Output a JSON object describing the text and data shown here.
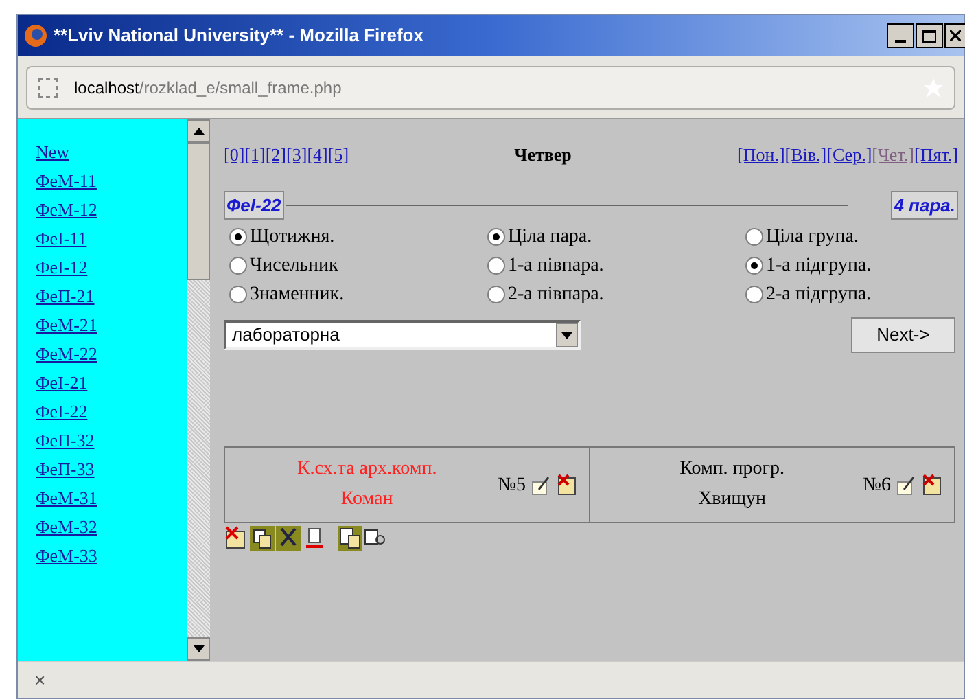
{
  "window": {
    "title": "**Lviv National University** - Mozilla Firefox"
  },
  "address_bar": {
    "host": "localhost",
    "path": "/rozklad_e/small_frame.php"
  },
  "sidebar": {
    "items": [
      "New",
      "ФеМ-11",
      "ФеМ-12",
      "ФеІ-11",
      "ФеІ-12",
      "ФеП-21",
      "ФеМ-21",
      "ФеМ-22",
      "ФеІ-21",
      "ФеІ-22",
      "ФеП-32",
      "ФеП-33",
      "ФеМ-31",
      "ФеМ-32",
      "ФеМ-33"
    ]
  },
  "pair_links": [
    "[0]",
    "[1]",
    "[2]",
    "[3]",
    "[4]",
    "[5]"
  ],
  "day_title": "Четвер",
  "day_links": [
    {
      "label": "[Пон.]",
      "selected": false
    },
    {
      "label": "[Вів.]",
      "selected": false
    },
    {
      "label": "[Сер.]",
      "selected": false
    },
    {
      "label": "[Чет.]",
      "selected": true
    },
    {
      "label": "[Пят.]",
      "selected": false
    }
  ],
  "group": "ФеІ-22",
  "pair": "4 пара.",
  "radio_groups": [
    [
      {
        "label": "Щотижня.",
        "selected": true
      },
      {
        "label": "Чисельник",
        "selected": false
      },
      {
        "label": "Знаменник.",
        "selected": false
      }
    ],
    [
      {
        "label": "Ціла пара.",
        "selected": true
      },
      {
        "label": "1-а півпара.",
        "selected": false
      },
      {
        "label": "2-а півпара.",
        "selected": false
      }
    ],
    [
      {
        "label": "Ціла група.",
        "selected": false
      },
      {
        "label": "1-а підгрупа.",
        "selected": true
      },
      {
        "label": "2-а підгрупа.",
        "selected": false
      }
    ]
  ],
  "lesson_type": "лабораторна",
  "next_button": "Next->",
  "lessons": [
    {
      "subject": "К.сх.та арх.комп.",
      "teacher": "Коман",
      "number": "№5",
      "color": "#ff2020"
    },
    {
      "subject": "Комп. прогр.",
      "teacher": "Хвищун",
      "number": "№6",
      "color": "#000000"
    }
  ],
  "status_bar": {
    "close": "×"
  }
}
